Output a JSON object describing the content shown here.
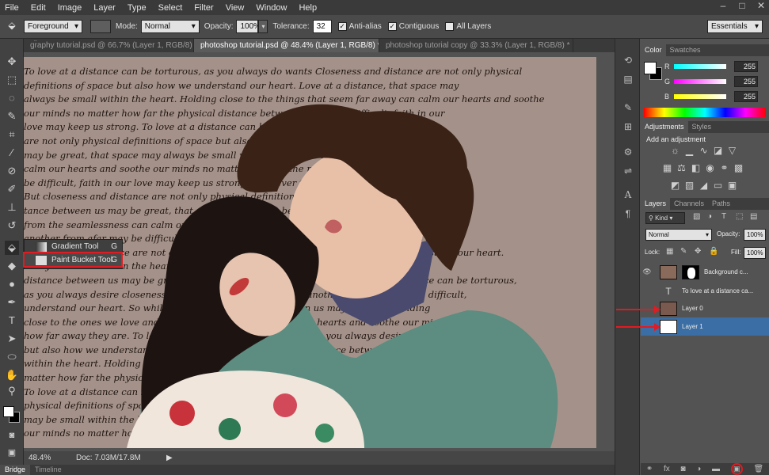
{
  "menubar": {
    "items": [
      "File",
      "Edit",
      "Image",
      "Layer",
      "Type",
      "Select",
      "Filter",
      "View",
      "Window",
      "Help"
    ],
    "window_controls": [
      "–",
      "□",
      "✕"
    ]
  },
  "options": {
    "fill_source": "Foreground",
    "mode_label": "Mode:",
    "mode_value": "Normal",
    "opacity_label": "Opacity:",
    "opacity_value": "100%",
    "tolerance_label": "Tolerance:",
    "tolerance_value": "32",
    "antialias_label": "Anti-alias",
    "contiguous_label": "Contiguous",
    "all_layers_label": "All Layers",
    "workspace": "Essentials"
  },
  "tabs": [
    "gr̈aphy tutorial.psd @ 66.7% (Layer 1, RGB/8) *",
    "photoshop tutorial.psd @ 48.4% (Layer 1, RGB/8) *",
    "photoshop tutorial copy @ 33.3% (Layer 1, RGB/8) *"
  ],
  "flyout": {
    "items": [
      {
        "label": "Gradient Tool",
        "shortcut": "G"
      },
      {
        "label": "Paint Bucket Tool",
        "shortcut": "G"
      }
    ]
  },
  "document_text": [
    "To love at a distance can be torturous, as you always do wants Closeness and distance are not only physical",
    "definitions of space but also how we understand our heart. Love at a distance, that space may",
    "always be small within the heart. Holding close to the things that seem far away can calm our hearts and soothe",
    "our minds no matter how far the physical distance between us may be difficult, faith in our",
    "love may keep us strong. To love at a distance can be torturous, closeness and distance",
    "are not only physical definitions of space but also how we understand our heart.",
    "may be great, that space may always be small within the heart. Our seamlessness can",
    "calm our hearts and soothe our minds no matter how far the physical distance from away may",
    "be difficult, faith in our love may keep us strong. Whatever the closeness to your beloved.",
    "But closeness and distance are not only physical definitions of space. So while the physical dis",
    "tance between us may be great, that space may always be small. While loving another",
    "from the seamlessness can calm our hearts and soothe our minds. Even though our closeness",
    "another from afar may be difficult, faith in our love may keep us strong, as you always desire",
    "closeness and distance are not only physical definitions of space but also how we understand our heart.",
    "always be small within the heart. Holding close to the ones we care",
    "distance between us may be great, that space may always be small. To love at a distance can be torturous,",
    "as you always desire closeness to your beloved. While loving another from afar may be difficult,",
    "understand our heart. So while the physical distance between us may be great. Holding",
    "close to the ones we love and trusting in our love can calm our hearts and soothe our minds no matter",
    "how far away they are. To love at a distance can be torturous, as you always desire closeness",
    "but also how we understand our heart. So while the physical distance between us may be great, that space",
    "within the heart. Holding close to the ones we love and trusting in our love can calm",
    "matter how far the physical distance between us may be difficult, faith in our love may",
    "To love at a distance can be torturous, as you always desire closeness to your beloved. But closeness",
    "physical definitions of space but also how we understand our heart. So while the physical distance",
    "may be small within the heart. Holding close to the ones we love and trusting in our love can calm",
    "our minds no matter how far away they are."
  ],
  "statusbar": {
    "zoom": "48.4%",
    "doc": "Doc: 7.03M/17.8M"
  },
  "bottomtabs": [
    "Bridge",
    "Timeline"
  ],
  "color_panel": {
    "tabs": [
      "Color",
      "Swatches"
    ],
    "channels": [
      {
        "label": "R",
        "value": "255",
        "color": "#00d8e8"
      },
      {
        "label": "G",
        "value": "255",
        "color": "#e040e0"
      },
      {
        "label": "B",
        "value": "255",
        "color": "#e8e000"
      }
    ]
  },
  "adjustments_panel": {
    "tabs": [
      "Adjustments",
      "Styles"
    ],
    "heading": "Add an adjustment"
  },
  "layers_panel": {
    "tabs": [
      "Layers",
      "Channels",
      "Paths"
    ],
    "kind": "Kind",
    "blend_mode": "Normal",
    "opacity_label": "Opacity:",
    "opacity_value": "100%",
    "lock_label": "Lock:",
    "fill_label": "Fill:",
    "fill_value": "100%",
    "layers": [
      {
        "name": "Background c..."
      },
      {
        "name": "To love at a distance ca..."
      },
      {
        "name": "Layer 0"
      },
      {
        "name": "Layer 1"
      }
    ]
  },
  "colors": {
    "highlight": "#e11b22",
    "selected_layer": "#3a6ea5"
  }
}
